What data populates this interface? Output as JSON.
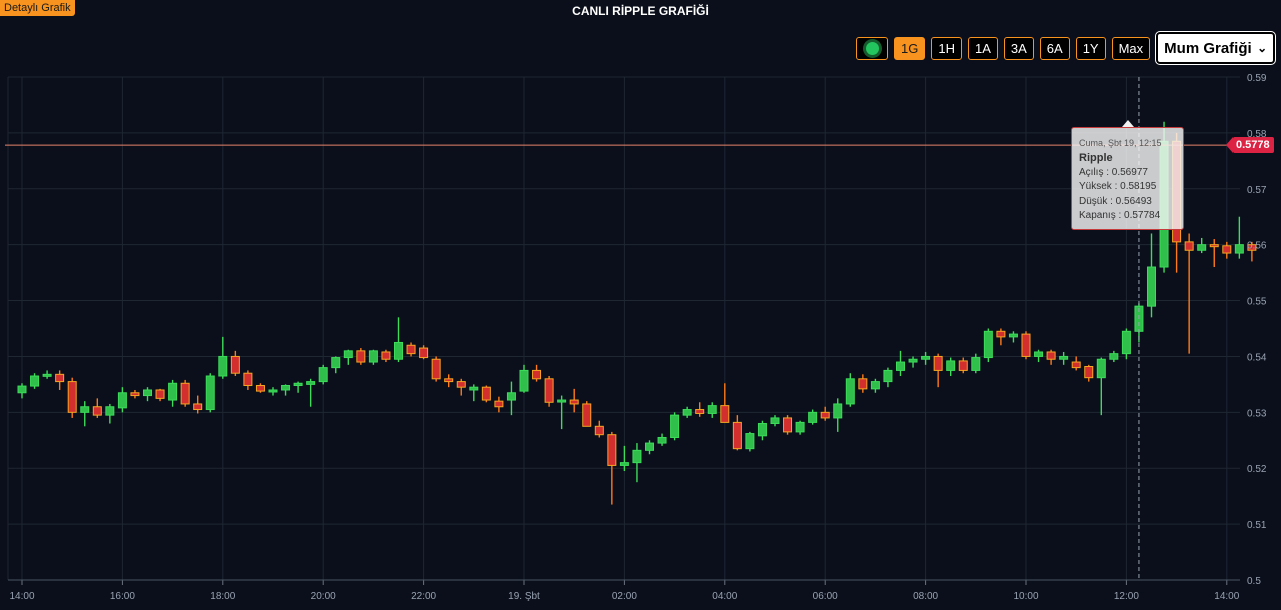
{
  "header": {
    "detail_label": "Detaylı Grafik",
    "title": "CANLI RİPPLE GRAFİĞİ"
  },
  "toolbar": {
    "live_indicator_color": "#22c55e",
    "ranges": [
      "1G",
      "1H",
      "1A",
      "3A",
      "6A",
      "1Y",
      "Max"
    ],
    "active_range": "1G",
    "chart_type_selected": "Mum Grafiği",
    "accent_color": "#f7931e"
  },
  "chart_data": {
    "type": "candlestick",
    "x_tick_labels": [
      "14:00",
      "16:00",
      "18:00",
      "20:00",
      "22:00",
      "19. Şbt",
      "02:00",
      "04:00",
      "06:00",
      "08:00",
      "10:00",
      "12:00",
      "14:00"
    ],
    "y_tick_labels": [
      "0.59",
      "0.58",
      "0.57",
      "0.56",
      "0.55",
      "0.54",
      "0.53",
      "0.52",
      "0.51",
      "0.5"
    ],
    "ylim": [
      0.5,
      0.59
    ],
    "up_color": "#2fbf4a",
    "down_color": "#d32f2f",
    "interval_minutes": 15,
    "ohlc": [
      [
        0.5335,
        0.5352,
        0.5325,
        0.5347
      ],
      [
        0.5347,
        0.537,
        0.5342,
        0.5365
      ],
      [
        0.5365,
        0.5375,
        0.536,
        0.5368
      ],
      [
        0.5368,
        0.5375,
        0.534,
        0.5355
      ],
      [
        0.5355,
        0.5362,
        0.529,
        0.53
      ],
      [
        0.53,
        0.532,
        0.5275,
        0.531
      ],
      [
        0.531,
        0.5325,
        0.529,
        0.5295
      ],
      [
        0.5295,
        0.5315,
        0.528,
        0.531
      ],
      [
        0.5308,
        0.5345,
        0.53,
        0.5335
      ],
      [
        0.5335,
        0.534,
        0.5325,
        0.533
      ],
      [
        0.533,
        0.5345,
        0.532,
        0.534
      ],
      [
        0.534,
        0.5342,
        0.532,
        0.5325
      ],
      [
        0.5322,
        0.5358,
        0.531,
        0.5352
      ],
      [
        0.5352,
        0.5358,
        0.531,
        0.5315
      ],
      [
        0.5315,
        0.533,
        0.5298,
        0.5305
      ],
      [
        0.5305,
        0.537,
        0.53,
        0.5365
      ],
      [
        0.5365,
        0.5435,
        0.536,
        0.54
      ],
      [
        0.54,
        0.541,
        0.5365,
        0.537
      ],
      [
        0.537,
        0.5375,
        0.534,
        0.5348
      ],
      [
        0.5348,
        0.5352,
        0.5335,
        0.5338
      ],
      [
        0.5338,
        0.5345,
        0.533,
        0.534
      ],
      [
        0.534,
        0.535,
        0.533,
        0.5348
      ],
      [
        0.5348,
        0.5355,
        0.5335,
        0.5352
      ],
      [
        0.535,
        0.536,
        0.531,
        0.5355
      ],
      [
        0.5355,
        0.5385,
        0.535,
        0.538
      ],
      [
        0.538,
        0.54,
        0.537,
        0.5398
      ],
      [
        0.5398,
        0.5412,
        0.5385,
        0.541
      ],
      [
        0.541,
        0.5415,
        0.5385,
        0.539
      ],
      [
        0.539,
        0.5412,
        0.5385,
        0.541
      ],
      [
        0.5408,
        0.5412,
        0.539,
        0.5395
      ],
      [
        0.5395,
        0.547,
        0.539,
        0.5425
      ],
      [
        0.542,
        0.5425,
        0.54,
        0.5405
      ],
      [
        0.5415,
        0.542,
        0.5395,
        0.5398
      ],
      [
        0.5395,
        0.54,
        0.5355,
        0.536
      ],
      [
        0.536,
        0.5368,
        0.5345,
        0.5355
      ],
      [
        0.5355,
        0.536,
        0.533,
        0.5345
      ],
      [
        0.534,
        0.535,
        0.532,
        0.5345
      ],
      [
        0.5345,
        0.5348,
        0.5318,
        0.5322
      ],
      [
        0.532,
        0.5328,
        0.53,
        0.531
      ],
      [
        0.5322,
        0.5355,
        0.5295,
        0.5335
      ],
      [
        0.5338,
        0.5385,
        0.5335,
        0.5375
      ],
      [
        0.5375,
        0.5385,
        0.5355,
        0.536
      ],
      [
        0.536,
        0.5365,
        0.531,
        0.5318
      ],
      [
        0.532,
        0.533,
        0.527,
        0.5322
      ],
      [
        0.5322,
        0.5342,
        0.53,
        0.5315
      ],
      [
        0.5315,
        0.532,
        0.5275,
        0.5275
      ],
      [
        0.5275,
        0.5285,
        0.5255,
        0.526
      ],
      [
        0.526,
        0.5265,
        0.5135,
        0.5205
      ],
      [
        0.5205,
        0.524,
        0.5195,
        0.521
      ],
      [
        0.521,
        0.5245,
        0.5175,
        0.5232
      ],
      [
        0.5232,
        0.525,
        0.5225,
        0.5245
      ],
      [
        0.5245,
        0.5262,
        0.524,
        0.5255
      ],
      [
        0.5255,
        0.53,
        0.525,
        0.5295
      ],
      [
        0.5295,
        0.531,
        0.529,
        0.5305
      ],
      [
        0.5305,
        0.5318,
        0.5292,
        0.5298
      ],
      [
        0.5298,
        0.5318,
        0.529,
        0.5312
      ],
      [
        0.5312,
        0.5352,
        0.5285,
        0.5282
      ],
      [
        0.5282,
        0.5295,
        0.5232,
        0.5235
      ],
      [
        0.5235,
        0.5265,
        0.523,
        0.5262
      ],
      [
        0.5258,
        0.5285,
        0.525,
        0.528
      ],
      [
        0.528,
        0.5295,
        0.5275,
        0.529
      ],
      [
        0.529,
        0.5295,
        0.526,
        0.5265
      ],
      [
        0.5265,
        0.5285,
        0.526,
        0.5282
      ],
      [
        0.5282,
        0.5305,
        0.5278,
        0.53
      ],
      [
        0.53,
        0.531,
        0.5285,
        0.529
      ],
      [
        0.529,
        0.5325,
        0.5265,
        0.5315
      ],
      [
        0.5315,
        0.537,
        0.531,
        0.536
      ],
      [
        0.536,
        0.5368,
        0.5335,
        0.5342
      ],
      [
        0.5342,
        0.536,
        0.5335,
        0.5355
      ],
      [
        0.5355,
        0.538,
        0.5345,
        0.5375
      ],
      [
        0.5375,
        0.541,
        0.5365,
        0.539
      ],
      [
        0.539,
        0.54,
        0.538,
        0.5395
      ],
      [
        0.5395,
        0.5408,
        0.5385,
        0.54
      ],
      [
        0.54,
        0.5405,
        0.5345,
        0.5375
      ],
      [
        0.5375,
        0.5398,
        0.5365,
        0.5392
      ],
      [
        0.5392,
        0.5398,
        0.537,
        0.5375
      ],
      [
        0.5375,
        0.5405,
        0.537,
        0.5398
      ],
      [
        0.5398,
        0.545,
        0.539,
        0.5445
      ],
      [
        0.5445,
        0.545,
        0.542,
        0.5435
      ],
      [
        0.5435,
        0.5445,
        0.5425,
        0.544
      ],
      [
        0.544,
        0.5445,
        0.5395,
        0.54
      ],
      [
        0.54,
        0.5412,
        0.539,
        0.5408
      ],
      [
        0.5408,
        0.5412,
        0.5385,
        0.5395
      ],
      [
        0.5395,
        0.5408,
        0.5385,
        0.54
      ],
      [
        0.539,
        0.54,
        0.5375,
        0.538
      ],
      [
        0.5382,
        0.5385,
        0.5355,
        0.5362
      ],
      [
        0.5362,
        0.5398,
        0.5295,
        0.5395
      ],
      [
        0.5395,
        0.541,
        0.539,
        0.5405
      ],
      [
        0.5405,
        0.545,
        0.5395,
        0.5445
      ],
      [
        0.5445,
        0.5495,
        0.5425,
        0.549
      ],
      [
        0.549,
        0.562,
        0.547,
        0.556
      ],
      [
        0.556,
        0.582,
        0.555,
        0.5785
      ],
      [
        0.5785,
        0.58,
        0.555,
        0.5605
      ],
      [
        0.5605,
        0.562,
        0.5405,
        0.559
      ],
      [
        0.559,
        0.5612,
        0.5585,
        0.56
      ],
      [
        0.56,
        0.561,
        0.556,
        0.5598
      ],
      [
        0.5598,
        0.5605,
        0.5575,
        0.5585
      ],
      [
        0.5585,
        0.565,
        0.5575,
        0.56
      ],
      [
        0.56,
        0.5605,
        0.557,
        0.559
      ]
    ]
  },
  "tooltip": {
    "date": "Cuma, Şbt 19, 12:15",
    "name": "Ripple",
    "open": "Açılış : 0.56977",
    "high": "Yüksek : 0.58195",
    "low": "Düşük : 0.56493",
    "close": "Kapanış : 0.57784"
  },
  "current_price": {
    "label": "0.5778",
    "color": "#dc2343"
  }
}
